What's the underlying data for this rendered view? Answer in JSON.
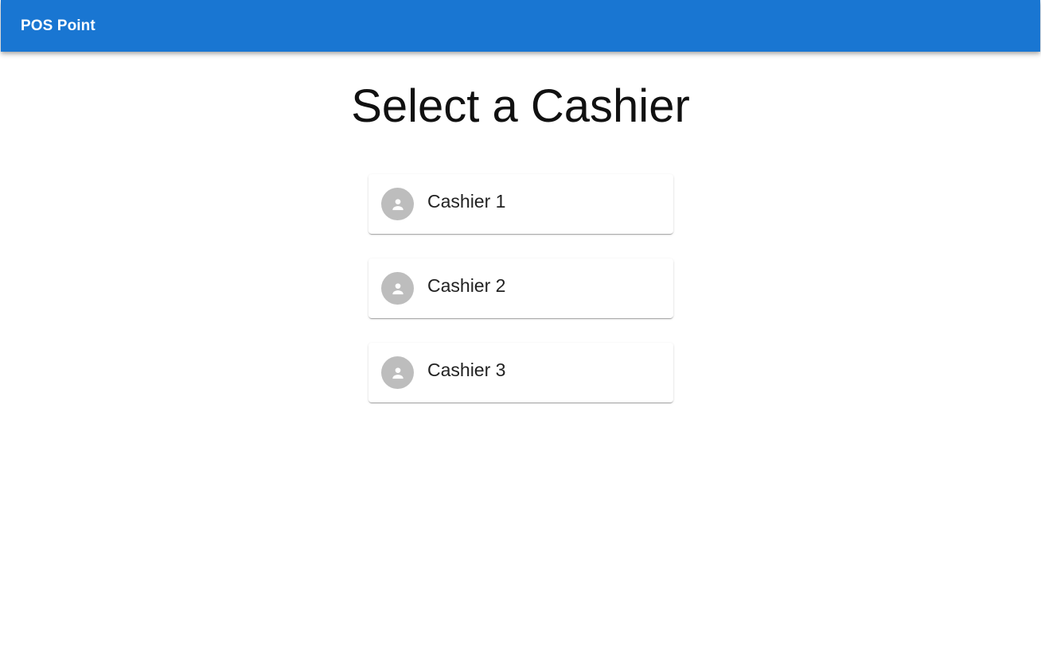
{
  "app_bar": {
    "title": "POS Point",
    "color": "#1976d2"
  },
  "page": {
    "title": "Select a Cashier"
  },
  "cashiers": [
    {
      "name": "Cashier 1",
      "icon": "person-icon"
    },
    {
      "name": "Cashier 2",
      "icon": "person-icon"
    },
    {
      "name": "Cashier 3",
      "icon": "person-icon"
    }
  ]
}
